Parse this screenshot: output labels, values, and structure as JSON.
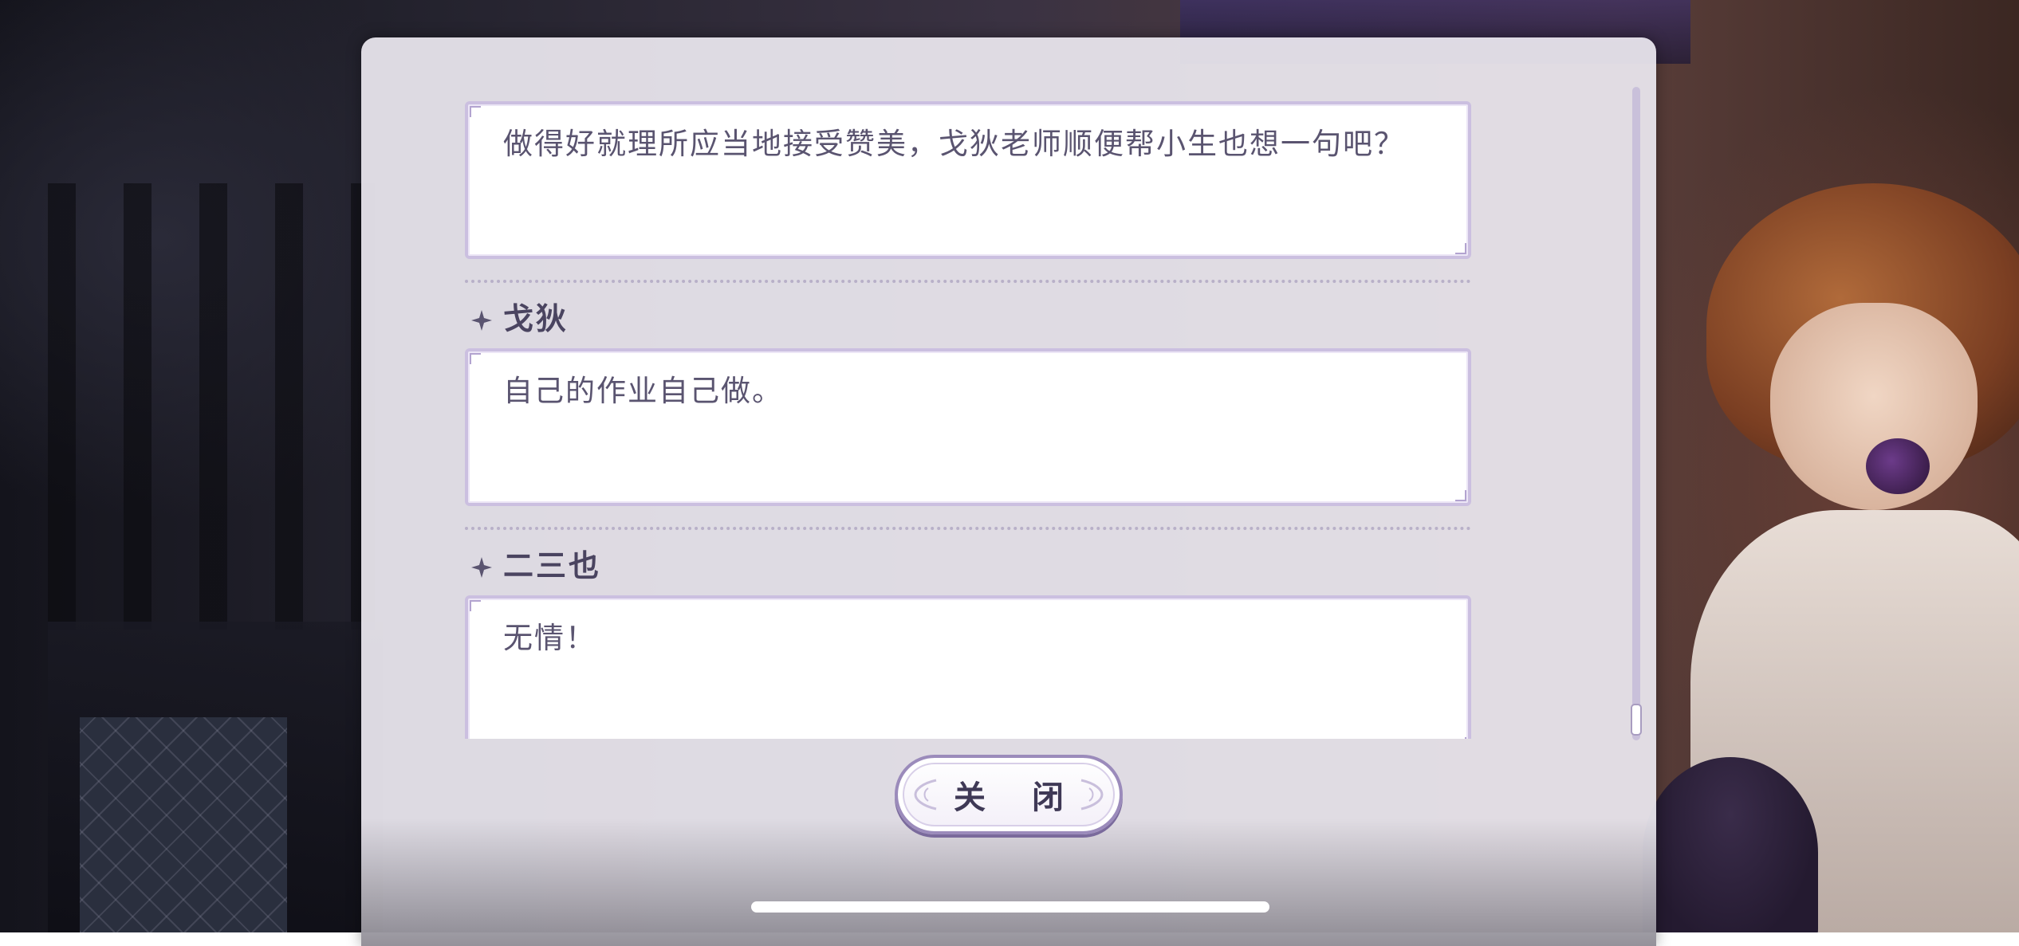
{
  "dialogue": [
    {
      "speaker": "",
      "text": "做得好就理所应当地接受赞美，戈狄老师顺便帮小生也想一句吧？"
    },
    {
      "speaker": "戈狄",
      "text": "自己的作业自己做。"
    },
    {
      "speaker": "二三也",
      "text": "无情！"
    }
  ],
  "close_button": {
    "label": "关 闭"
  },
  "scroll": {
    "position_fraction": 0.95
  },
  "colors": {
    "panel_bg": "#ECE8F0",
    "box_border": "#CBBFE0",
    "text": "#5A5470",
    "name_text": "#4A4460"
  }
}
